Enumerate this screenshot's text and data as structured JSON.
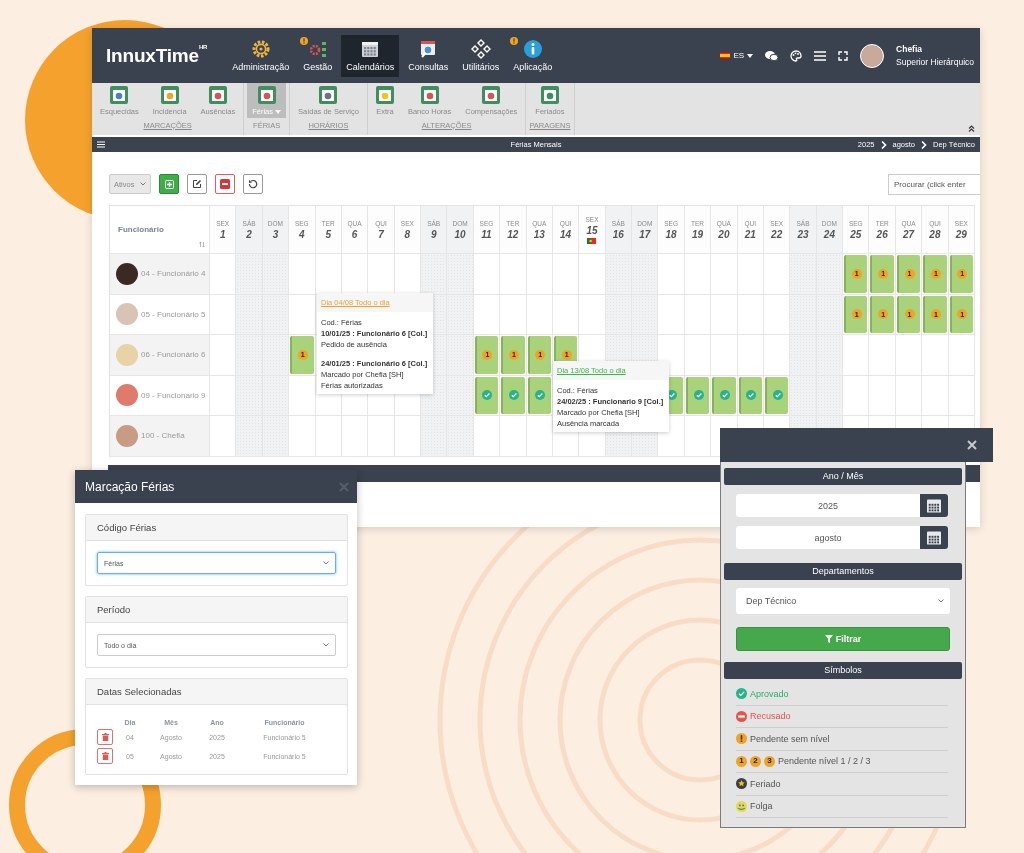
{
  "app": {
    "logo": "InnuxTime$^{HR}$",
    "nav": [
      {
        "label": "Administração",
        "kind": "gear",
        "alert": false,
        "selected": false
      },
      {
        "label": "Gestão",
        "kind": "modules",
        "alert": true,
        "selected": false
      },
      {
        "label": "Calendários",
        "kind": "calendar",
        "alert": false,
        "selected": true
      },
      {
        "label": "Consultas",
        "kind": "query",
        "alert": false,
        "selected": false
      },
      {
        "label": "Utilitários",
        "kind": "tools",
        "alert": false,
        "selected": false
      },
      {
        "label": "Aplicação",
        "kind": "info",
        "alert": true,
        "selected": false
      }
    ],
    "language": "ES",
    "user": {
      "name": "Chefia",
      "role": "Superior Hierárquico"
    }
  },
  "ribbon": {
    "groups": [
      {
        "label": "MARCAÇÕES",
        "selected": false,
        "items": [
          {
            "label": "Esquecidas",
            "selected": false,
            "dropdown": false
          },
          {
            "label": "Incidencia",
            "selected": false,
            "dropdown": false
          },
          {
            "label": "Ausências",
            "selected": false,
            "dropdown": false
          }
        ]
      },
      {
        "label": "FÉRIAS",
        "selected": true,
        "items": [
          {
            "label": "Férias",
            "selected": true,
            "dropdown": true
          }
        ]
      },
      {
        "label": "HORÁRIOS",
        "selected": false,
        "items": [
          {
            "label": "Saídas de Serviço",
            "selected": false,
            "dropdown": false
          }
        ]
      },
      {
        "label": "ALTERAÇÕES",
        "selected": false,
        "items": [
          {
            "label": "Extra",
            "selected": false,
            "dropdown": false
          },
          {
            "label": "Banco Horas",
            "selected": false,
            "dropdown": false
          },
          {
            "label": "Compensações",
            "selected": false,
            "dropdown": false
          }
        ]
      },
      {
        "label": "PARAGENS",
        "selected": false,
        "items": [
          {
            "label": "Feriados",
            "selected": false,
            "dropdown": false
          }
        ]
      }
    ]
  },
  "title_bar": {
    "title": "Férias Mensais",
    "breadcrumb": [
      "2025",
      "agosto",
      "Dep Técnico"
    ]
  },
  "toolbar": {
    "status_filter": "Ativos",
    "search": {
      "placeholder": "Procurar (click enter"
    }
  },
  "grid": {
    "column_header": "Funcionário",
    "days": [
      {
        "weekday": "SEX",
        "day": "1",
        "weekend": false,
        "holiday": false
      },
      {
        "weekday": "SÁB",
        "day": "2",
        "weekend": true,
        "holiday": false
      },
      {
        "weekday": "DOM",
        "day": "3",
        "weekend": true,
        "holiday": false
      },
      {
        "weekday": "SEG",
        "day": "4",
        "weekend": false,
        "holiday": false
      },
      {
        "weekday": "TER",
        "day": "5",
        "weekend": false,
        "holiday": false
      },
      {
        "weekday": "QUA",
        "day": "6",
        "weekend": false,
        "holiday": false
      },
      {
        "weekday": "QUI",
        "day": "7",
        "weekend": false,
        "holiday": false
      },
      {
        "weekday": "SEX",
        "day": "8",
        "weekend": false,
        "holiday": false
      },
      {
        "weekday": "SÁB",
        "day": "9",
        "weekend": true,
        "holiday": false
      },
      {
        "weekday": "DOM",
        "day": "10",
        "weekend": true,
        "holiday": false
      },
      {
        "weekday": "SEG",
        "day": "11",
        "weekend": false,
        "holiday": false
      },
      {
        "weekday": "TER",
        "day": "12",
        "weekend": false,
        "holiday": false
      },
      {
        "weekday": "QUA",
        "day": "13",
        "weekend": false,
        "holiday": false
      },
      {
        "weekday": "QUI",
        "day": "14",
        "weekend": false,
        "holiday": false
      },
      {
        "weekday": "SEX",
        "day": "15",
        "weekend": false,
        "holiday": true
      },
      {
        "weekday": "SÁB",
        "day": "16",
        "weekend": true,
        "holiday": false
      },
      {
        "weekday": "DOM",
        "day": "17",
        "weekend": true,
        "holiday": false
      },
      {
        "weekday": "SEG",
        "day": "18",
        "weekend": false,
        "holiday": false
      },
      {
        "weekday": "TER",
        "day": "19",
        "weekend": false,
        "holiday": false
      },
      {
        "weekday": "QUA",
        "day": "20",
        "weekend": false,
        "holiday": false
      },
      {
        "weekday": "QUI",
        "day": "21",
        "weekend": false,
        "holiday": false
      },
      {
        "weekday": "SEX",
        "day": "22",
        "weekend": false,
        "holiday": false
      },
      {
        "weekday": "SÁB",
        "day": "23",
        "weekend": true,
        "holiday": false
      },
      {
        "weekday": "DOM",
        "day": "24",
        "weekend": true,
        "holiday": false
      },
      {
        "weekday": "SEG",
        "day": "25",
        "weekend": false,
        "holiday": false
      },
      {
        "weekday": "TER",
        "day": "26",
        "weekend": false,
        "holiday": false
      },
      {
        "weekday": "QUA",
        "day": "27",
        "weekend": false,
        "holiday": false
      },
      {
        "weekday": "QUI",
        "day": "28",
        "weekend": false,
        "holiday": false
      },
      {
        "weekday": "SEX",
        "day": "29",
        "weekend": false,
        "holiday": false
      }
    ],
    "rows": [
      {
        "name": "04 - Funcionário 4",
        "cells": [
          {
            "kind": "empty"
          },
          {
            "kind": "empty"
          },
          {
            "kind": "empty"
          },
          {
            "kind": "empty"
          },
          {
            "kind": "empty"
          },
          {
            "kind": "empty"
          },
          {
            "kind": "empty"
          },
          {
            "kind": "empty"
          },
          {
            "kind": "empty"
          },
          {
            "kind": "empty"
          },
          {
            "kind": "empty"
          },
          {
            "kind": "empty"
          },
          {
            "kind": "empty"
          },
          {
            "kind": "empty"
          },
          {
            "kind": "empty"
          },
          {
            "kind": "empty"
          },
          {
            "kind": "empty"
          },
          {
            "kind": "empty"
          },
          {
            "kind": "empty"
          },
          {
            "kind": "empty"
          },
          {
            "kind": "empty"
          },
          {
            "kind": "empty"
          },
          {
            "kind": "empty"
          },
          {
            "kind": "empty"
          },
          {
            "kind": "pending",
            "badge": "1"
          },
          {
            "kind": "pending",
            "badge": "1"
          },
          {
            "kind": "pending",
            "badge": "1"
          },
          {
            "kind": "pending",
            "badge": "1"
          },
          {
            "kind": "pending",
            "badge": "1"
          }
        ]
      },
      {
        "name": "05 - Funcionário 5",
        "cells": [
          {
            "kind": "empty"
          },
          {
            "kind": "empty"
          },
          {
            "kind": "empty"
          },
          {
            "kind": "empty"
          },
          {
            "kind": "empty"
          },
          {
            "kind": "empty"
          },
          {
            "kind": "empty"
          },
          {
            "kind": "empty"
          },
          {
            "kind": "empty"
          },
          {
            "kind": "empty"
          },
          {
            "kind": "empty"
          },
          {
            "kind": "empty"
          },
          {
            "kind": "empty"
          },
          {
            "kind": "empty"
          },
          {
            "kind": "empty"
          },
          {
            "kind": "empty"
          },
          {
            "kind": "empty"
          },
          {
            "kind": "empty"
          },
          {
            "kind": "empty"
          },
          {
            "kind": "empty"
          },
          {
            "kind": "empty"
          },
          {
            "kind": "empty"
          },
          {
            "kind": "empty"
          },
          {
            "kind": "empty"
          },
          {
            "kind": "pending",
            "badge": "1"
          },
          {
            "kind": "pending",
            "badge": "1"
          },
          {
            "kind": "pending",
            "badge": "1"
          },
          {
            "kind": "pending",
            "badge": "1"
          },
          {
            "kind": "pending",
            "badge": "1"
          }
        ]
      },
      {
        "name": "06 - Funcionário 6",
        "cells": [
          {
            "kind": "empty"
          },
          {
            "kind": "empty"
          },
          {
            "kind": "empty"
          },
          {
            "kind": "pending",
            "badge": "1"
          },
          {
            "kind": "empty"
          },
          {
            "kind": "empty"
          },
          {
            "kind": "empty"
          },
          {
            "kind": "empty"
          },
          {
            "kind": "empty"
          },
          {
            "kind": "empty"
          },
          {
            "kind": "pending",
            "badge": "1"
          },
          {
            "kind": "pending",
            "badge": "1"
          },
          {
            "kind": "pending",
            "badge": "1"
          },
          {
            "kind": "pending",
            "badge": "1"
          },
          {
            "kind": "empty"
          },
          {
            "kind": "empty"
          },
          {
            "kind": "empty"
          },
          {
            "kind": "empty"
          },
          {
            "kind": "empty"
          },
          {
            "kind": "empty"
          },
          {
            "kind": "empty"
          },
          {
            "kind": "empty"
          },
          {
            "kind": "empty"
          },
          {
            "kind": "empty"
          },
          {
            "kind": "empty"
          },
          {
            "kind": "empty"
          },
          {
            "kind": "empty"
          },
          {
            "kind": "empty"
          },
          {
            "kind": "empty"
          }
        ]
      },
      {
        "name": "09 - Funcionario 9",
        "cells": [
          {
            "kind": "empty"
          },
          {
            "kind": "empty"
          },
          {
            "kind": "empty"
          },
          {
            "kind": "empty"
          },
          {
            "kind": "empty"
          },
          {
            "kind": "empty"
          },
          {
            "kind": "empty"
          },
          {
            "kind": "empty"
          },
          {
            "kind": "empty"
          },
          {
            "kind": "empty"
          },
          {
            "kind": "approved"
          },
          {
            "kind": "approved"
          },
          {
            "kind": "approved"
          },
          {
            "kind": "empty"
          },
          {
            "kind": "empty"
          },
          {
            "kind": "empty"
          },
          {
            "kind": "empty"
          },
          {
            "kind": "approved"
          },
          {
            "kind": "approved"
          },
          {
            "kind": "approved"
          },
          {
            "kind": "approved"
          },
          {
            "kind": "approved"
          },
          {
            "kind": "empty"
          },
          {
            "kind": "empty"
          },
          {
            "kind": "empty"
          },
          {
            "kind": "empty"
          },
          {
            "kind": "empty"
          },
          {
            "kind": "empty"
          },
          {
            "kind": "empty"
          }
        ]
      },
      {
        "name": "100 - Chefia",
        "cells": [
          {
            "kind": "empty"
          },
          {
            "kind": "empty"
          },
          {
            "kind": "empty"
          },
          {
            "kind": "empty"
          },
          {
            "kind": "empty"
          },
          {
            "kind": "empty"
          },
          {
            "kind": "empty"
          },
          {
            "kind": "empty"
          },
          {
            "kind": "empty"
          },
          {
            "kind": "empty"
          },
          {
            "kind": "empty"
          },
          {
            "kind": "empty"
          },
          {
            "kind": "empty"
          },
          {
            "kind": "empty"
          },
          {
            "kind": "empty"
          },
          {
            "kind": "empty"
          },
          {
            "kind": "empty"
          },
          {
            "kind": "empty"
          },
          {
            "kind": "empty"
          },
          {
            "kind": "empty"
          },
          {
            "kind": "empty"
          },
          {
            "kind": "empty"
          },
          {
            "kind": "empty"
          },
          {
            "kind": "empty"
          },
          {
            "kind": "empty"
          },
          {
            "kind": "empty"
          },
          {
            "kind": "empty"
          },
          {
            "kind": "empty"
          },
          {
            "kind": "empty"
          }
        ]
      }
    ]
  },
  "tooltips": [
    {
      "title": "Dia 04/08 Todo o dia",
      "kind": "pending",
      "sections": [
        {
          "lines": [
            {
              "text": "Cod.: Férias",
              "bold": false
            },
            {
              "text": "10/01/25 : Funcionário 6 [Col.]",
              "bold": true
            },
            {
              "text": "Pedido de ausência",
              "bold": false
            }
          ]
        },
        {
          "lines": [
            {
              "text": "24/01/25 : Funcionário 6 [Col.]",
              "bold": true
            },
            {
              "text": "Marcado por Chefia [SH]",
              "bold": false
            },
            {
              "text": "Férias autorizadas",
              "bold": false
            }
          ]
        }
      ]
    },
    {
      "title": "Dia 13/08 Todo o dia",
      "kind": "approved",
      "sections": [
        {
          "lines": [
            {
              "text": "Cod.: Férias",
              "bold": false
            },
            {
              "text": "24/02/25 : Funcionario 9 [Col.]",
              "bold": true
            },
            {
              "text": "Marcado por Chefia [SH]",
              "bold": false
            },
            {
              "text": "Ausência marcada",
              "bold": false
            }
          ]
        }
      ]
    }
  ],
  "dialog": {
    "title": "Marcação Férias",
    "code": {
      "label": "Código Férias",
      "value": "Férias",
      "focused": true
    },
    "period": {
      "label": "Período",
      "value": "Todo o dia",
      "focused": false
    },
    "dates": {
      "label": "Datas Selecionadas",
      "columns": [
        "Dia",
        "Mês",
        "Ano",
        "Funcionário"
      ],
      "rows": [
        [
          "04",
          "Agosto",
          "2025",
          "Funcionário 5"
        ],
        [
          "05",
          "Agosto",
          "2025",
          "Funcionário 5"
        ]
      ]
    }
  },
  "panel": {
    "year_month": {
      "title": "Ano / Mês",
      "year": "2025",
      "month": "agosto"
    },
    "departments": {
      "title": "Departamentos",
      "value": "Dep Técnico",
      "button": "Filtrar"
    },
    "symbols": {
      "title": "Símbolos",
      "items": [
        {
          "kind": "approved",
          "label": "Aprovado"
        },
        {
          "kind": "refused",
          "label": "Recusado"
        },
        {
          "kind": "pending",
          "label": "Pendente sem nível"
        },
        {
          "kind": "levels",
          "label": "Pendente nível 1 / 2 / 3",
          "badges": [
            "1",
            "2",
            "3"
          ]
        },
        {
          "kind": "holiday",
          "label": "Feriado"
        },
        {
          "kind": "dayoff",
          "label": "Folga"
        }
      ]
    }
  }
}
